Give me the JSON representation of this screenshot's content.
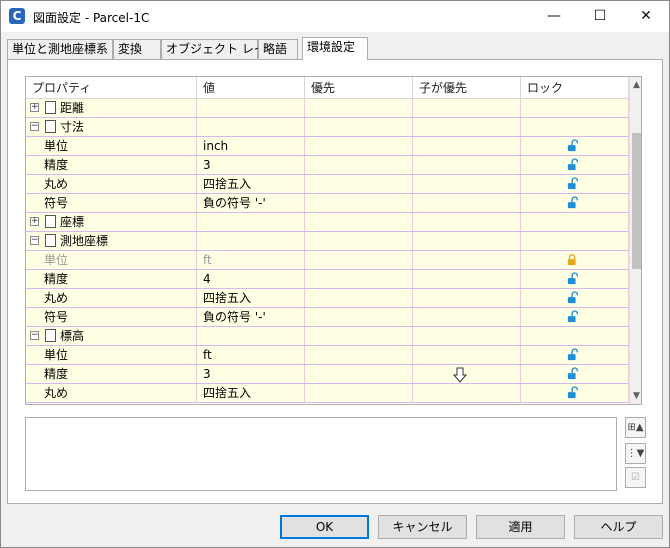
{
  "window": {
    "title": "図面設定 - Parcel-1C",
    "app_icon_letter": "C"
  },
  "controls": {
    "minimize": "—",
    "maximize": "☐",
    "close": "✕"
  },
  "tabs": [
    {
      "label": "単位と測地座標系"
    },
    {
      "label": "変換"
    },
    {
      "label": "オブジェクト レイヤ"
    },
    {
      "label": "略語"
    },
    {
      "label": "環境設定"
    }
  ],
  "grid": {
    "headers": [
      "プロパティ",
      "値",
      "優先",
      "子が優先",
      "ロック"
    ],
    "rows": [
      {
        "type": "category",
        "expanded": false,
        "label": "距離"
      },
      {
        "type": "category",
        "expanded": true,
        "label": "寸法"
      },
      {
        "type": "prop",
        "label": "単位",
        "value": "inch",
        "lock": "unlocked"
      },
      {
        "type": "prop",
        "label": "精度",
        "value": "3",
        "lock": "unlocked"
      },
      {
        "type": "prop",
        "label": "丸め",
        "value": "四捨五入",
        "lock": "unlocked"
      },
      {
        "type": "prop",
        "label": "符号",
        "value": "負の符号 '-'",
        "lock": "unlocked"
      },
      {
        "type": "category",
        "expanded": false,
        "label": "座標"
      },
      {
        "type": "category",
        "expanded": true,
        "label": "測地座標"
      },
      {
        "type": "prop",
        "label": "単位",
        "value": "ft",
        "lock": "locked",
        "disabled": true
      },
      {
        "type": "prop",
        "label": "精度",
        "value": "4",
        "lock": "unlocked"
      },
      {
        "type": "prop",
        "label": "丸め",
        "value": "四捨五入",
        "lock": "unlocked"
      },
      {
        "type": "prop",
        "label": "符号",
        "value": "負の符号 '-'",
        "lock": "unlocked"
      },
      {
        "type": "category",
        "expanded": true,
        "label": "標高"
      },
      {
        "type": "prop",
        "label": "単位",
        "value": "ft",
        "lock": "unlocked"
      },
      {
        "type": "prop",
        "label": "精度",
        "value": "3",
        "lock": "unlocked"
      },
      {
        "type": "prop",
        "label": "丸め",
        "value": "四捨五入",
        "lock": "unlocked"
      }
    ]
  },
  "buttons": {
    "ok": "OK",
    "cancel": "キャンセル",
    "apply": "適用",
    "help": "ヘルプ"
  },
  "colors": {
    "row_bg": "#ffffe4",
    "lock_unlocked": "#1e8fd6",
    "lock_locked": "#e3a51a",
    "focus": "#0078d7"
  }
}
